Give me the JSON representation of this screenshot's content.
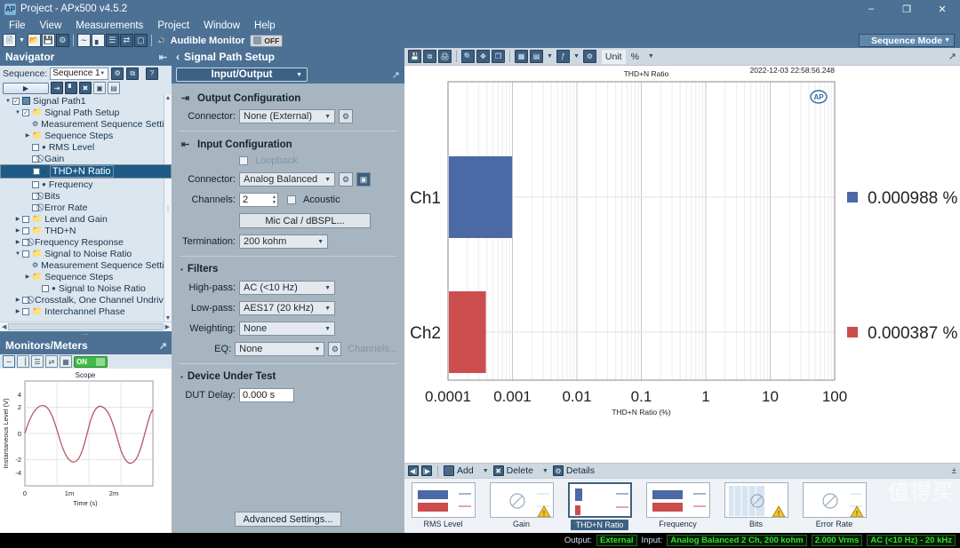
{
  "window": {
    "title": "Project - APx500 v4.5.2",
    "minimize": "–",
    "maximize": "❐",
    "close": "✕"
  },
  "menu": [
    "File",
    "View",
    "Measurements",
    "Project",
    "Window",
    "Help"
  ],
  "toolbar": {
    "audible_monitor_label": "Audible Monitor",
    "audible_monitor_state": "OFF",
    "sequence_mode": "Sequence Mode",
    "icons": [
      "new-document-icon",
      "open-icon",
      "save-icon",
      "settings-icon",
      "signal-path-icon",
      "bar-graph-icon",
      "list-icon",
      "io-icon",
      "generator-icon",
      "speaker-icon"
    ]
  },
  "navigator": {
    "title": "Navigator",
    "sequence_label": "Sequence:",
    "sequence_value": "Sequence 1",
    "tree": [
      {
        "label": "Signal Path1",
        "depth": 0,
        "arrow": "▼",
        "checkbox": true,
        "checked": true,
        "glyph": "signal",
        "selected": false
      },
      {
        "label": "Signal Path Setup",
        "depth": 1,
        "arrow": "▼",
        "checkbox": true,
        "checked": true,
        "glyph": "folder",
        "selected": false
      },
      {
        "label": "Measurement Sequence Settings..",
        "depth": 2,
        "arrow": "",
        "checkbox": false,
        "checked": false,
        "glyph": "gear",
        "selected": false
      },
      {
        "label": "Sequence Steps",
        "depth": 2,
        "arrow": "▶",
        "checkbox": false,
        "checked": false,
        "glyph": "folder",
        "selected": false
      },
      {
        "label": "RMS Level",
        "depth": 2,
        "arrow": "",
        "checkbox": true,
        "checked": false,
        "glyph": "dot",
        "selected": false
      },
      {
        "label": "Gain",
        "depth": 2,
        "arrow": "",
        "checkbox": true,
        "checked": false,
        "glyph": "ban",
        "selected": false
      },
      {
        "label": "THD+N Ratio",
        "depth": 2,
        "arrow": "",
        "checkbox": true,
        "checked": false,
        "glyph": "dot",
        "selected": true
      },
      {
        "label": "Frequency",
        "depth": 2,
        "arrow": "",
        "checkbox": true,
        "checked": false,
        "glyph": "dot",
        "selected": false
      },
      {
        "label": "Bits",
        "depth": 2,
        "arrow": "",
        "checkbox": true,
        "checked": false,
        "glyph": "ban",
        "selected": false
      },
      {
        "label": "Error Rate",
        "depth": 2,
        "arrow": "",
        "checkbox": true,
        "checked": false,
        "glyph": "ban",
        "selected": false
      },
      {
        "label": "Level and Gain",
        "depth": 1,
        "arrow": "▶",
        "checkbox": true,
        "checked": false,
        "glyph": "folder",
        "selected": false
      },
      {
        "label": "THD+N",
        "depth": 1,
        "arrow": "▶",
        "checkbox": true,
        "checked": false,
        "glyph": "folder",
        "selected": false
      },
      {
        "label": "Frequency Response",
        "depth": 1,
        "arrow": "▶",
        "checkbox": true,
        "checked": false,
        "glyph": "ban",
        "selected": false
      },
      {
        "label": "Signal to Noise Ratio",
        "depth": 1,
        "arrow": "▼",
        "checkbox": true,
        "checked": false,
        "glyph": "folder",
        "selected": false
      },
      {
        "label": "Measurement Sequence Settings..",
        "depth": 2,
        "arrow": "",
        "checkbox": false,
        "checked": false,
        "glyph": "gear",
        "selected": false
      },
      {
        "label": "Sequence Steps",
        "depth": 2,
        "arrow": "▶",
        "checkbox": false,
        "checked": false,
        "glyph": "folder",
        "selected": false
      },
      {
        "label": "Signal to Noise Ratio",
        "depth": 3,
        "arrow": "",
        "checkbox": true,
        "checked": false,
        "glyph": "dot",
        "selected": false
      },
      {
        "label": "Crosstalk, One Channel Undriven",
        "depth": 1,
        "arrow": "▶",
        "checkbox": true,
        "checked": false,
        "glyph": "ban",
        "selected": false
      },
      {
        "label": "Interchannel Phase",
        "depth": 1,
        "arrow": "▶",
        "checkbox": true,
        "checked": false,
        "glyph": "folder",
        "selected": false
      }
    ]
  },
  "monitors": {
    "title": "Monitors/Meters",
    "power_state": "ON",
    "scope": {
      "title": "Scope",
      "ylabel": "Instantaneous Level (V)",
      "xlabel": "Time (s)",
      "yticks": [
        "4",
        "2",
        "0",
        "-2",
        "-4"
      ],
      "xticks": [
        "0",
        "1m",
        "2m"
      ]
    }
  },
  "signal_path_setup": {
    "title": "Signal Path Setup",
    "back_icon": "‹",
    "selector": "Input/Output",
    "output_configuration": {
      "title": "Output Configuration",
      "connector_label": "Connector:",
      "connector_value": "None (External)"
    },
    "input_configuration": {
      "title": "Input Configuration",
      "loopback_label": "Loopback",
      "connector_label": "Connector:",
      "connector_value": "Analog Balanced",
      "channels_label": "Channels:",
      "channels_value": "2",
      "acoustic_label": "Acoustic",
      "mic_cal_button": "Mic Cal / dBSPL...",
      "termination_label": "Termination:",
      "termination_value": "200 kohm"
    },
    "filters": {
      "title": "Filters",
      "highpass_label": "High-pass:",
      "highpass_value": "AC (<10 Hz)",
      "lowpass_label": "Low-pass:",
      "lowpass_value": "AES17 (20 kHz)",
      "weighting_label": "Weighting:",
      "weighting_value": "None",
      "eq_label": "EQ:",
      "eq_value": "None",
      "channels_button": "Channels..."
    },
    "device_under_test": {
      "title": "Device Under Test",
      "dut_delay_label": "DUT Delay:",
      "dut_delay_value": "0.000 s"
    },
    "advanced_button": "Advanced Settings..."
  },
  "chart_toolbar": {
    "unit_label": "Unit",
    "unit_value": "%",
    "icons": [
      "save-icon",
      "copy-icon",
      "print-icon",
      "zoom-icon",
      "fit-icon",
      "expand-icon",
      "table-icon",
      "legend-icon",
      "cursor-icon",
      "settings-icon"
    ]
  },
  "chart_data": {
    "type": "bar",
    "orientation": "horizontal",
    "title": "THD+N Ratio",
    "timestamp": "2022-12-03 22:58:56.248",
    "categories": [
      "Ch1",
      "Ch2"
    ],
    "values": [
      0.000988,
      0.000387
    ],
    "value_labels": [
      "0.000988 %",
      "0.000387 %"
    ],
    "colors": [
      "#4a69a5",
      "#cc4d4d"
    ],
    "xlabel": "THD+N Ratio (%)",
    "ylabel": "",
    "xscale": "log",
    "xlim": [
      0.0001,
      100
    ],
    "xticks": [
      "0.0001",
      "0.001",
      "0.01",
      "0.1",
      "1",
      "10",
      "100"
    ],
    "grid": true,
    "legend_position": "right",
    "watermark": "AP"
  },
  "measurement_bar": {
    "add_label": "Add",
    "delete_label": "Delete",
    "details_label": "Details",
    "first_icon": "⏮",
    "last_icon": "⏭"
  },
  "measurement_cards": [
    {
      "label": "RMS Level",
      "type": "bars",
      "active": false,
      "warning": false
    },
    {
      "label": "Gain",
      "type": "empty",
      "active": false,
      "warning": true
    },
    {
      "label": "THD+N Ratio",
      "type": "smallbars",
      "active": true,
      "warning": false
    },
    {
      "label": "Frequency",
      "type": "bars",
      "active": false,
      "warning": false
    },
    {
      "label": "Bits",
      "type": "stripes",
      "active": false,
      "warning": true
    },
    {
      "label": "Error Rate",
      "type": "empty",
      "active": false,
      "warning": true
    }
  ],
  "status_bar": {
    "output_label": "Output:",
    "output_value": "External",
    "input_label": "Input:",
    "input_value": "Analog Balanced 2 Ch, 200 kohm",
    "level_value": "2.000 Vrms",
    "filter_value": "AC (<10 Hz) - 20 kHz"
  },
  "watermark": "值得买"
}
